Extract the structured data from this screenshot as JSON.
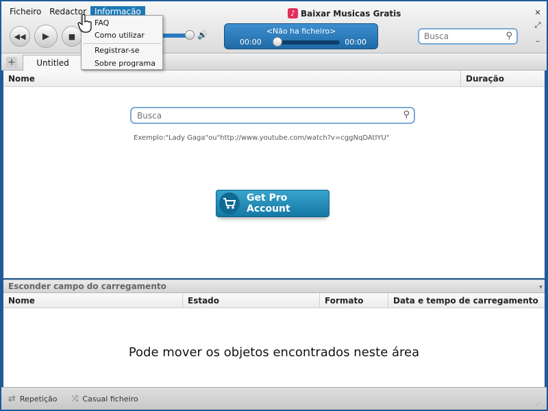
{
  "menu": {
    "items": [
      "Ficheiro",
      "Redactor",
      "Informação"
    ],
    "active_index": 2
  },
  "app": {
    "title": "Baixar Musicas Gratis",
    "icon": "music-note-icon"
  },
  "dropdown": {
    "items": [
      "FAQ",
      "Como utilizar",
      "Registrar-se",
      "Sobre programa"
    ]
  },
  "player": {
    "now_playing": "<Não ha ficheiro>",
    "time_elapsed": "00:00",
    "time_total": "00:00",
    "progress": 0,
    "volume": 0.85
  },
  "top_search": {
    "placeholder": "Busca"
  },
  "tabs": {
    "items": [
      "Untitled"
    ]
  },
  "results_table": {
    "columns": [
      "Nome",
      "Duração"
    ]
  },
  "center_search": {
    "placeholder": "Busca",
    "example": "Exemplo:\"Lady Gaga\"ou\"http://www.youtube.com/watch?v=cggNqDAtIYU\""
  },
  "pro_button": {
    "label": "Get Pro Account"
  },
  "downloads": {
    "header": "Esconder campo do carregamento",
    "columns": [
      "Nome",
      "Estado",
      "Formato",
      "Data e tempo de carregamento"
    ],
    "empty_message": "Pode mover os objetos encontrados neste área"
  },
  "statusbar": {
    "repeat_label": "Repetição",
    "shuffle_label": "Casual ficheiro"
  },
  "colors": {
    "accent_blue": "#1f6aa6",
    "menu_highlight": "#1d7ab6",
    "pro_button": "#1478a4",
    "frame": "#1e5a98"
  }
}
